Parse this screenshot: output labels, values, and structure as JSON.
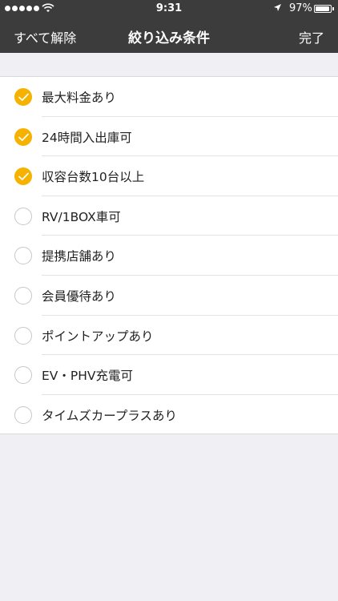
{
  "status_bar": {
    "time": "9:31",
    "battery": "97%",
    "battery_level": 0.97
  },
  "nav": {
    "left_label": "すべて解除",
    "title": "絞り込み条件",
    "right_label": "完了"
  },
  "colors": {
    "accent": "#f6b200",
    "bar": "#3c3c3c",
    "background": "#efeff4"
  },
  "filters": [
    {
      "label": "最大料金あり",
      "checked": true
    },
    {
      "label": "24時間入出庫可",
      "checked": true
    },
    {
      "label": "収容台数10台以上",
      "checked": true
    },
    {
      "label": "RV/1BOX車可",
      "checked": false
    },
    {
      "label": "提携店舗あり",
      "checked": false
    },
    {
      "label": "会員優待あり",
      "checked": false
    },
    {
      "label": "ポイントアップあり",
      "checked": false
    },
    {
      "label": "EV・PHV充電可",
      "checked": false
    },
    {
      "label": "タイムズカープラスあり",
      "checked": false
    }
  ]
}
